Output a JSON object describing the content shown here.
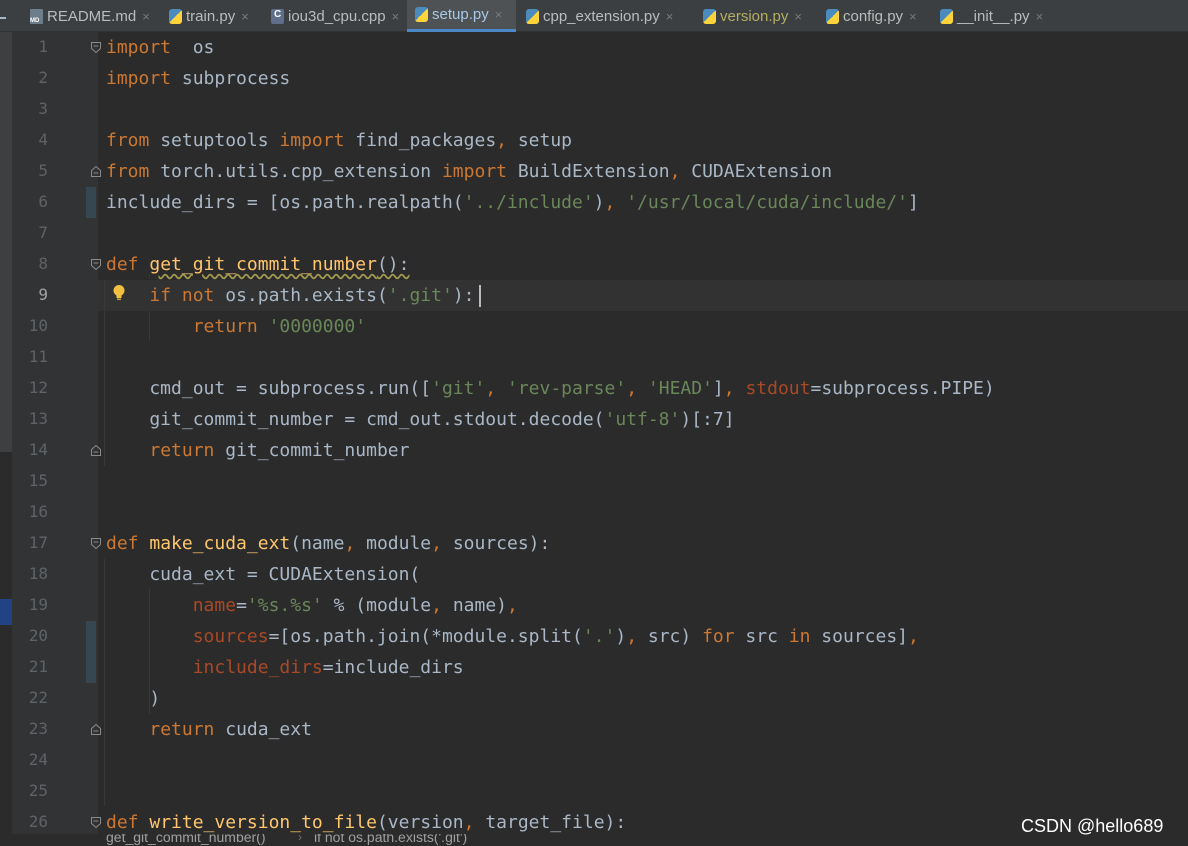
{
  "tabs": [
    {
      "label": "README.md",
      "icon": "markdown-file-icon",
      "kind": "md",
      "active": false,
      "modified": false
    },
    {
      "label": "train.py",
      "icon": "python-file-icon",
      "kind": "py",
      "active": false,
      "modified": false
    },
    {
      "label": "iou3d_cpu.cpp",
      "icon": "cpp-file-icon",
      "kind": "cpp",
      "active": false,
      "modified": false
    },
    {
      "label": "setup.py",
      "icon": "python-file-icon",
      "kind": "py",
      "active": true,
      "modified": false
    },
    {
      "label": "cpp_extension.py",
      "icon": "python-file-icon",
      "kind": "py",
      "active": false,
      "modified": false
    },
    {
      "label": "version.py",
      "icon": "python-file-icon",
      "kind": "py",
      "active": false,
      "modified": true
    },
    {
      "label": "config.py",
      "icon": "python-file-icon",
      "kind": "py",
      "active": false,
      "modified": false
    },
    {
      "label": "__init__.py",
      "icon": "python-file-icon",
      "kind": "py",
      "active": false,
      "modified": false
    }
  ],
  "tab_close_glyph": "×",
  "editor": {
    "current_line": 9,
    "lines": [
      {
        "n": "1",
        "tokens": [
          [
            "kw",
            "import"
          ],
          [
            "",
            "  os"
          ]
        ]
      },
      {
        "n": "2",
        "tokens": [
          [
            "kw",
            "import"
          ],
          [
            "",
            " subprocess"
          ]
        ]
      },
      {
        "n": "3",
        "tokens": []
      },
      {
        "n": "4",
        "tokens": [
          [
            "kw",
            "from"
          ],
          [
            "",
            " setuptools "
          ],
          [
            "kw",
            "import"
          ],
          [
            "",
            " find_packages"
          ],
          [
            "kw",
            ","
          ],
          [
            "",
            " setup"
          ]
        ]
      },
      {
        "n": "5",
        "tokens": [
          [
            "kw",
            "from"
          ],
          [
            "",
            " torch.utils.cpp_extension "
          ],
          [
            "kw",
            "import"
          ],
          [
            "",
            " BuildExtension"
          ],
          [
            "kw",
            ","
          ],
          [
            "",
            " CUDAExtension"
          ]
        ]
      },
      {
        "n": "6",
        "tokens": [
          [
            "",
            "include_dirs = [os.path.realpath("
          ],
          [
            "str",
            "'../include'"
          ],
          [
            "",
            ")"
          ],
          [
            "kw",
            ","
          ],
          [
            "",
            " "
          ],
          [
            "str",
            "'/usr/local/cuda/include/'"
          ],
          [
            "",
            "]"
          ]
        ]
      },
      {
        "n": "7",
        "tokens": []
      },
      {
        "n": "8",
        "tokens": [
          [
            "kw",
            "def"
          ],
          [
            "",
            " "
          ],
          [
            "fn warn",
            "get_git_commit_number"
          ],
          [
            "warn",
            "():"
          ]
        ]
      },
      {
        "n": "9",
        "tokens": [
          [
            "",
            "    "
          ],
          [
            "kw",
            "if not"
          ],
          [
            "",
            " os.path.exists("
          ],
          [
            "str",
            "'.git'"
          ],
          [
            "",
            "):"
          ]
        ]
      },
      {
        "n": "10",
        "tokens": [
          [
            "",
            "        "
          ],
          [
            "kw",
            "return"
          ],
          [
            "",
            " "
          ],
          [
            "str",
            "'0000000'"
          ]
        ]
      },
      {
        "n": "11",
        "tokens": []
      },
      {
        "n": "12",
        "tokens": [
          [
            "",
            "    cmd_out = subprocess.run(["
          ],
          [
            "str",
            "'git'"
          ],
          [
            "kw",
            ","
          ],
          [
            "",
            " "
          ],
          [
            "str",
            "'rev-parse'"
          ],
          [
            "kw",
            ","
          ],
          [
            "",
            " "
          ],
          [
            "str",
            "'HEAD'"
          ],
          [
            "",
            "]"
          ],
          [
            "kw",
            ","
          ],
          [
            "",
            " "
          ],
          [
            "param",
            "stdout"
          ],
          [
            "",
            "=subprocess.PIPE)"
          ]
        ]
      },
      {
        "n": "13",
        "tokens": [
          [
            "",
            "    git_commit_number = cmd_out.stdout.decode("
          ],
          [
            "str",
            "'utf-8'"
          ],
          [
            "",
            ")[:7]"
          ]
        ]
      },
      {
        "n": "14",
        "tokens": [
          [
            "",
            "    "
          ],
          [
            "kw",
            "return"
          ],
          [
            "",
            " git_commit_number"
          ]
        ]
      },
      {
        "n": "15",
        "tokens": []
      },
      {
        "n": "16",
        "tokens": []
      },
      {
        "n": "17",
        "tokens": [
          [
            "kw",
            "def"
          ],
          [
            "",
            " "
          ],
          [
            "fn",
            "make_cuda_ext"
          ],
          [
            "",
            "(name"
          ],
          [
            "kw",
            ","
          ],
          [
            "",
            " module"
          ],
          [
            "kw",
            ","
          ],
          [
            "",
            " sources):"
          ]
        ]
      },
      {
        "n": "18",
        "tokens": [
          [
            "",
            "    cuda_ext = CUDAExtension("
          ]
        ]
      },
      {
        "n": "19",
        "tokens": [
          [
            "",
            "        "
          ],
          [
            "param",
            "name"
          ],
          [
            "",
            "="
          ],
          [
            "str",
            "'%s.%s'"
          ],
          [
            "",
            " % (module"
          ],
          [
            "kw",
            ","
          ],
          [
            "",
            " name)"
          ],
          [
            "kw",
            ","
          ]
        ]
      },
      {
        "n": "20",
        "tokens": [
          [
            "",
            "        "
          ],
          [
            "param",
            "sources"
          ],
          [
            "",
            "=[os.path.join(*module.split("
          ],
          [
            "str",
            "'.'"
          ],
          [
            "",
            ")"
          ],
          [
            "kw",
            ","
          ],
          [
            "",
            " src) "
          ],
          [
            "kw",
            "for"
          ],
          [
            "",
            " src "
          ],
          [
            "kw",
            "in"
          ],
          [
            "",
            " sources]"
          ],
          [
            "kw",
            ","
          ]
        ]
      },
      {
        "n": "21",
        "tokens": [
          [
            "",
            "        "
          ],
          [
            "param",
            "include_dirs"
          ],
          [
            "",
            "=include_dirs"
          ]
        ]
      },
      {
        "n": "22",
        "tokens": [
          [
            "",
            "    )"
          ]
        ]
      },
      {
        "n": "23",
        "tokens": [
          [
            "",
            "    "
          ],
          [
            "kw",
            "return"
          ],
          [
            "",
            " cuda_ext"
          ]
        ]
      },
      {
        "n": "24",
        "tokens": []
      },
      {
        "n": "25",
        "tokens": []
      },
      {
        "n": "26",
        "tokens": [
          [
            "kw",
            "def"
          ],
          [
            "",
            " "
          ],
          [
            "fn",
            "write_version_to_file"
          ],
          [
            "",
            "(version"
          ],
          [
            "kw",
            ","
          ],
          [
            "",
            " target_file):"
          ]
        ]
      }
    ]
  },
  "breadcrumb": {
    "items": [
      "get_git_commit_number()",
      "if not os.path.exists('.git')"
    ],
    "separator": "›"
  },
  "watermark": "CSDN @hello689"
}
